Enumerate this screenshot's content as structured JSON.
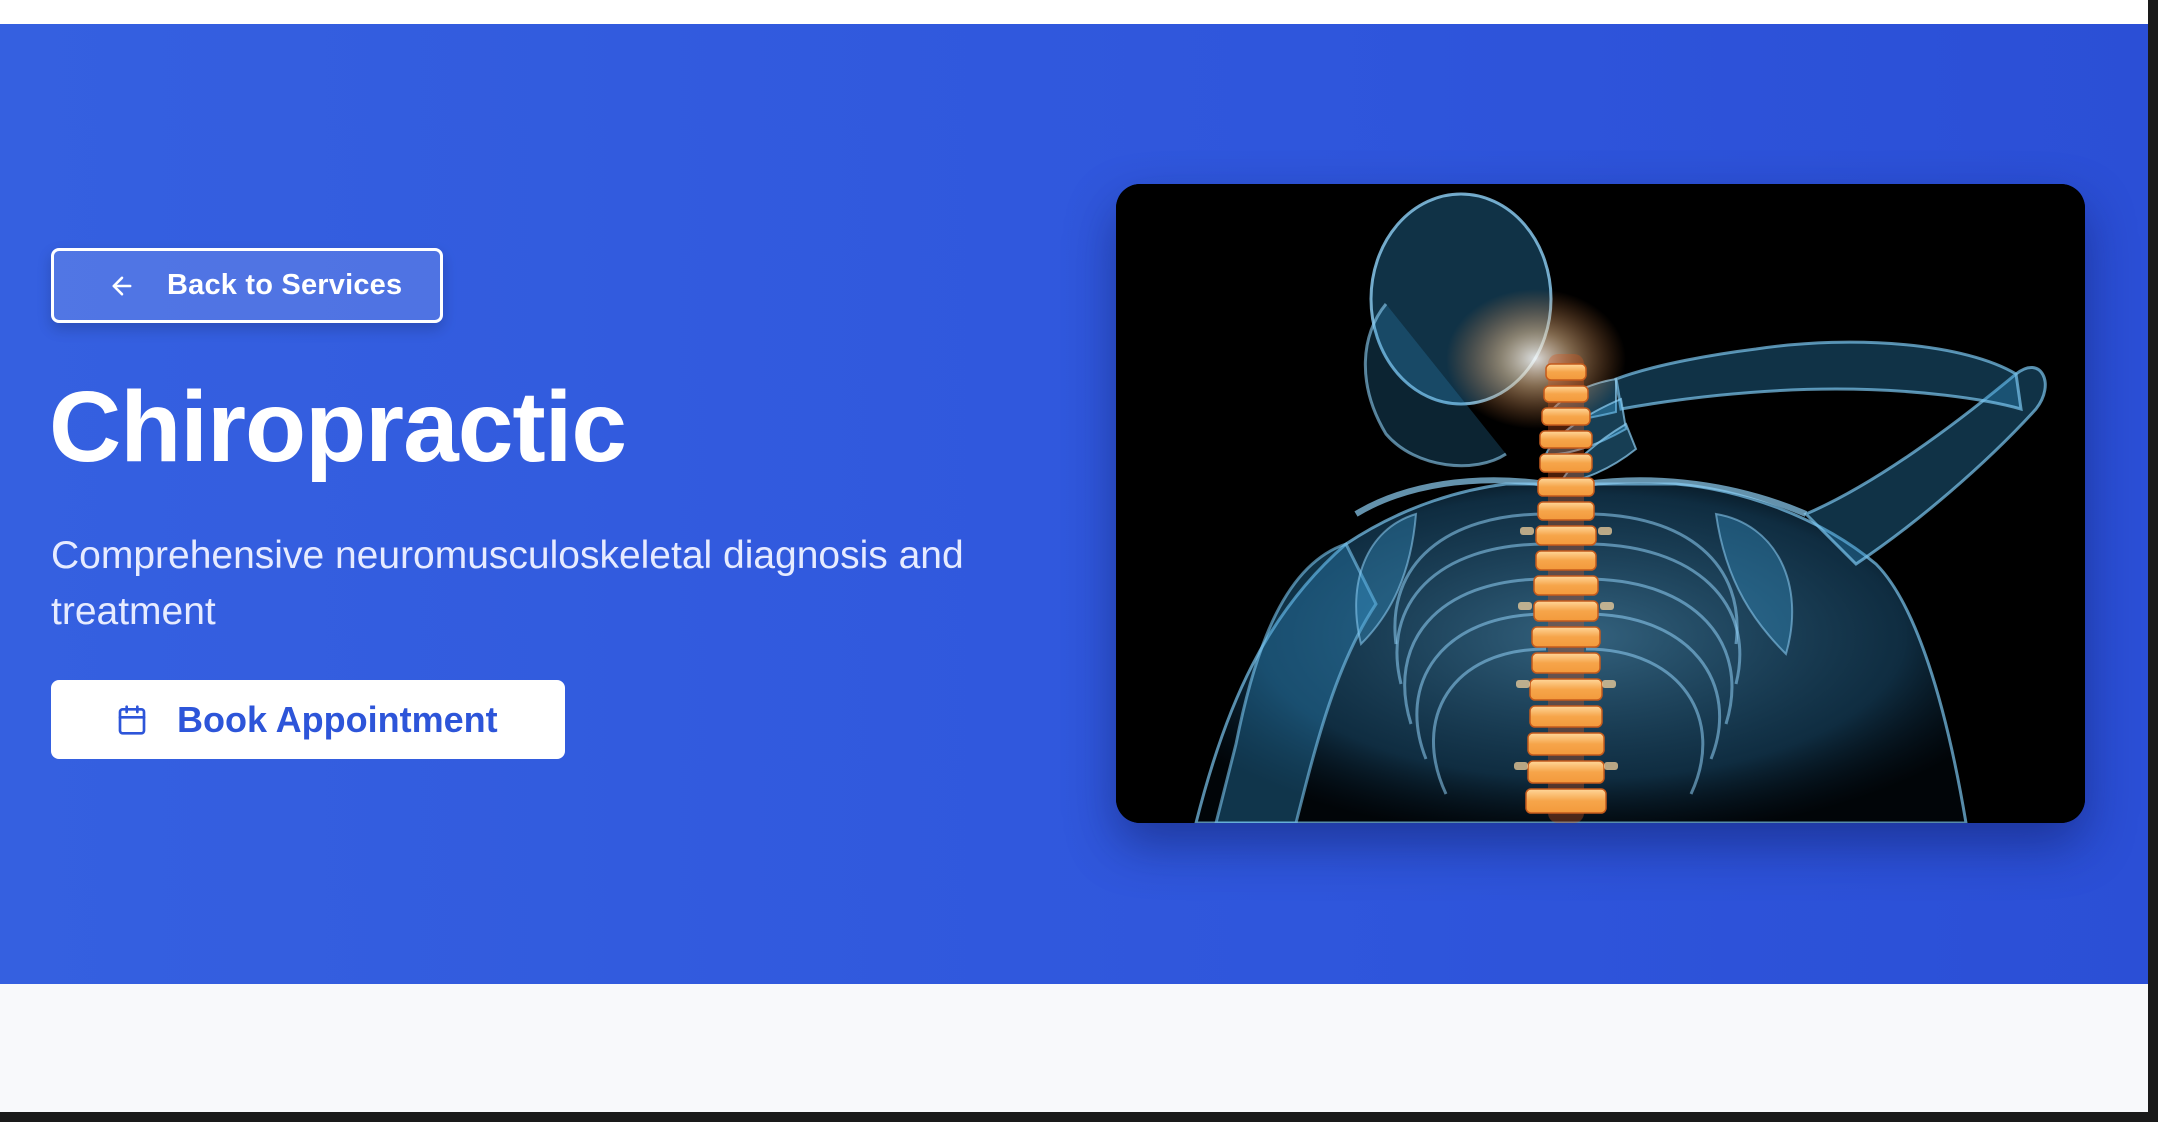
{
  "hero": {
    "back_label": "Back to Services",
    "title": "Chiropractic",
    "subtitle": "Comprehensive neuromusculoskeletal diagnosis and treatment",
    "book_label": "Book Appointment",
    "image_alt": "X-ray illustration of a human skeleton highlighting the spine",
    "colors": {
      "hero_bg": "#2f56dc",
      "button_text": "#2d55d9",
      "spine_highlight": "#f5a443"
    }
  },
  "icons": {
    "back": "arrow-left-icon",
    "book": "calendar-icon"
  }
}
